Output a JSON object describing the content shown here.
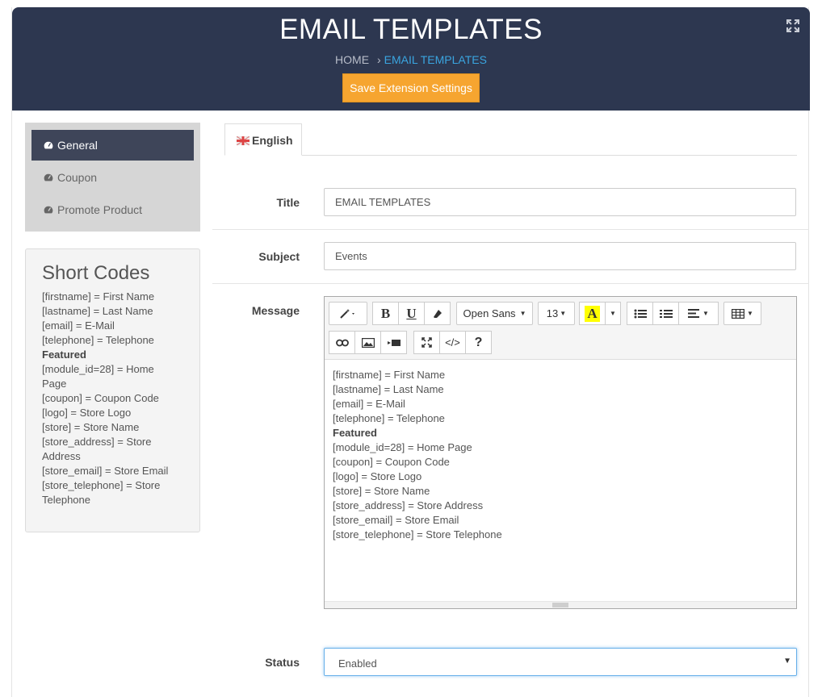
{
  "header": {
    "title": "EMAIL TEMPLATES",
    "breadcrumb": {
      "home": "HOME",
      "separator": "›",
      "current": "EMAIL TEMPLATES"
    },
    "save_label": "Save Extension Settings",
    "colors": {
      "bg": "#2d3750",
      "accent": "#3aa5e0",
      "save": "#f6a530"
    }
  },
  "sidebar": {
    "items": [
      {
        "label": "General",
        "icon": "dashboard-icon",
        "active": true
      },
      {
        "label": "Coupon",
        "icon": "dashboard-icon",
        "active": false
      },
      {
        "label": "Promote Product",
        "icon": "dashboard-icon",
        "active": false
      }
    ]
  },
  "shortcodes": {
    "title": "Short Codes",
    "lines": [
      "[firstname] = First Name",
      "[lastname] = Last Name",
      "[email] = E-Mail",
      "[telephone] = Telephone",
      "Featured",
      "[module_id=28] = Home",
      "Page",
      "[coupon] = Coupon Code",
      "[logo] = Store Logo",
      "[store] = Store Name",
      "[store_address] = Store",
      "Address",
      "[store_email] = Store Email",
      "[store_telephone] = Store",
      "Telephone"
    ]
  },
  "tabs": [
    {
      "label": "English",
      "icon": "uk-flag-icon"
    }
  ],
  "form": {
    "title_label": "Title",
    "title_value": "EMAIL TEMPLATES",
    "subject_label": "Subject",
    "subject_value": "Events",
    "message_label": "Message",
    "status_label": "Status",
    "status_value": "Enabled"
  },
  "editor": {
    "font_name": "Open Sans",
    "font_size": "13",
    "color_letter": "A",
    "help": "?",
    "code": "</>",
    "lines": [
      "[firstname] = First Name",
      "[lastname] = Last Name",
      "[email] = E-Mail",
      "[telephone] = Telephone",
      "Featured",
      "[module_id=28] = Home Page",
      "[coupon] = Coupon Code",
      "[logo] = Store Logo",
      "[store] = Store Name",
      "[store_address] = Store Address",
      "[store_email] = Store Email",
      "[store_telephone] = Store Telephone"
    ]
  }
}
